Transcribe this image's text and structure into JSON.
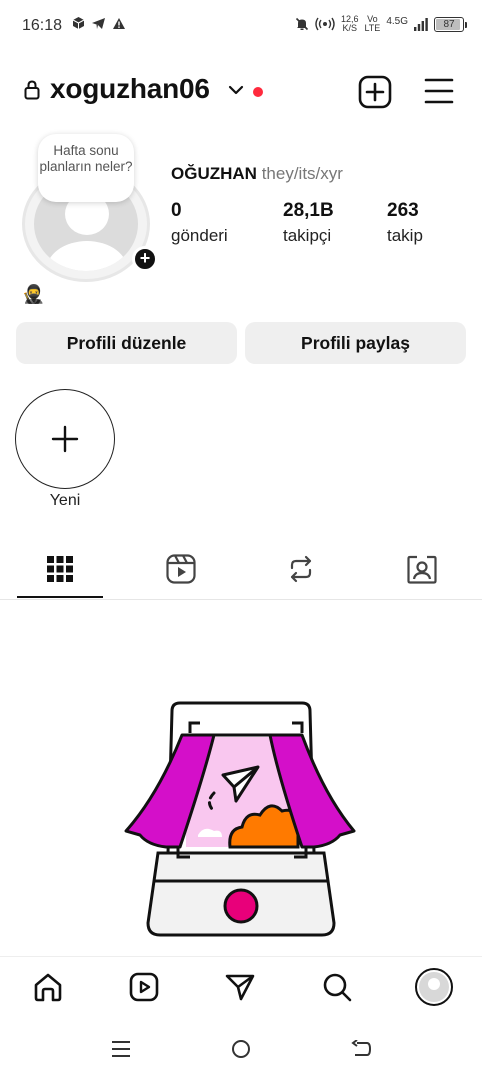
{
  "status_bar": {
    "time": "16:18",
    "speed_value": "12,6",
    "speed_unit": "K/S",
    "volte_top": "Vo",
    "volte_bottom": "LTE",
    "network": "4.5G",
    "battery": "87"
  },
  "header": {
    "username": "xoguzhan06"
  },
  "profile": {
    "note": "Hafta sonu planların neler?",
    "emoji": "🥷",
    "full_name": "OĞUZHAN",
    "pronouns": "they/its/xyr",
    "stats": [
      {
        "value": "0",
        "label": "gönderi"
      },
      {
        "value": "28,1B",
        "label": "takipçi"
      },
      {
        "value": "263",
        "label": "takip"
      }
    ]
  },
  "buttons": {
    "edit_profile": "Profili düzenle",
    "share_profile": "Profili paylaş"
  },
  "highlights": {
    "new_label": "Yeni"
  },
  "tabs": [
    {
      "icon": "grid-icon"
    },
    {
      "icon": "reels-icon"
    },
    {
      "icon": "reposts-icon"
    },
    {
      "icon": "tagged-icon"
    }
  ],
  "bottom_nav": [
    {
      "icon": "home-icon"
    },
    {
      "icon": "reels-icon"
    },
    {
      "icon": "direct-message-icon"
    },
    {
      "icon": "search-icon"
    },
    {
      "icon": "profile-avatar"
    }
  ],
  "colors": {
    "notification_dot": "#ff2a3d",
    "illustration_magenta": "#d40fc9",
    "illustration_orange": "#ff7a00",
    "illustration_pink": "#f9c7ef",
    "record_button": "#e8007a"
  }
}
